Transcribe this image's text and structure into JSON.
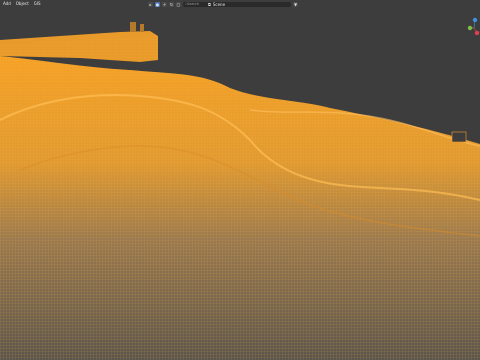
{
  "menu": [
    {
      "label": "Add"
    },
    {
      "label": "Object"
    },
    {
      "label": "GIS"
    }
  ],
  "toolbar": {
    "icons": [
      "select-icon",
      "cursor-icon",
      "move-icon",
      "rotate-icon",
      "scale-icon",
      "transform-icon",
      "annotate-icon"
    ],
    "search_placeholder": "Search",
    "filter_icon": "filter-icon"
  },
  "scene": {
    "label": "Scene"
  },
  "colors": {
    "background": "#3d3d3d",
    "wire": "#f5a126",
    "mesh_shadow": "#6e5f48",
    "gizmo_x": "#e04050",
    "gizmo_y": "#80c040",
    "gizmo_z": "#4090e0"
  }
}
